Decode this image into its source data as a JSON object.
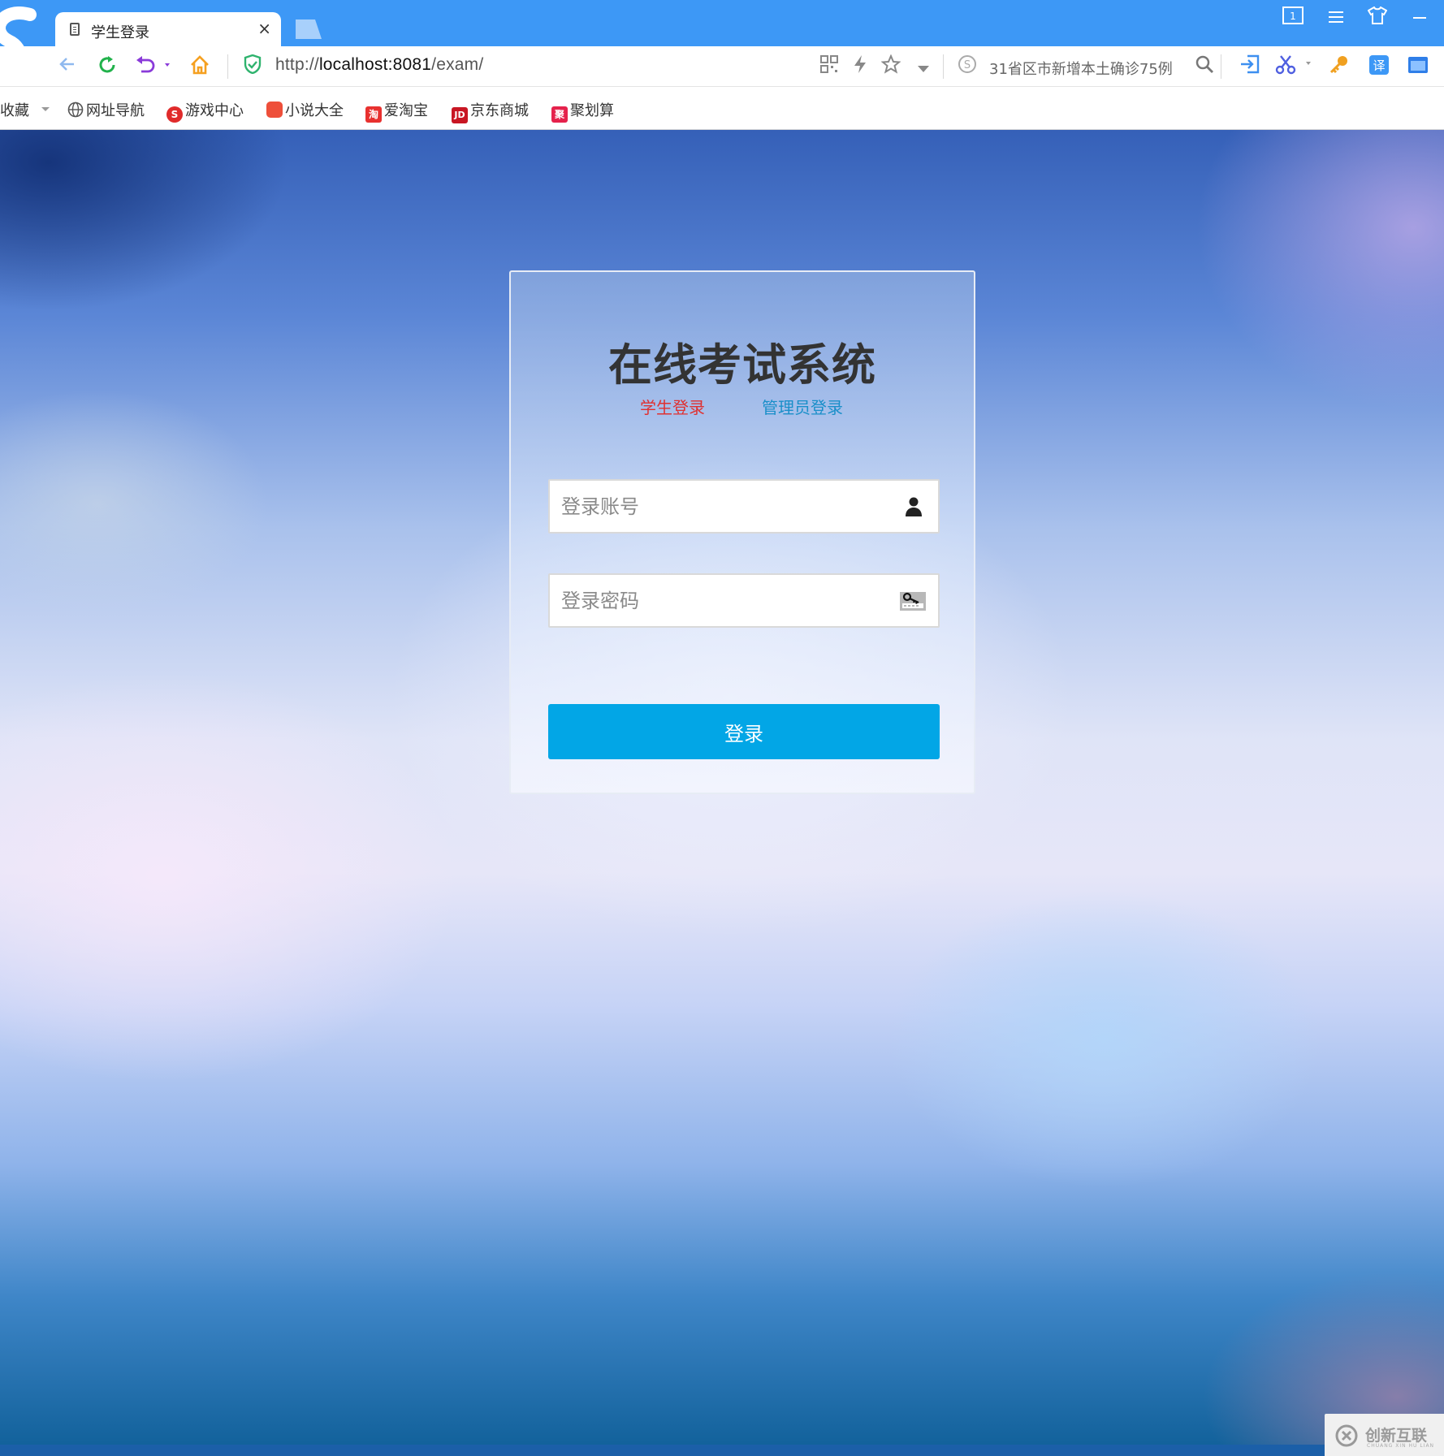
{
  "browser": {
    "tab_title": "学生登录",
    "tab_close": "×",
    "url_scheme": "http://",
    "url_host": "localhost:8081",
    "url_path": "/exam/",
    "news_ticker": "31省区市新增本土确诊75例",
    "window_counter": "1"
  },
  "bookmarks": [
    {
      "label": "收藏",
      "icon": "star-dropdown"
    },
    {
      "label": "网址导航",
      "icon": "globe-icon"
    },
    {
      "label": "游戏中心",
      "icon": "game-icon",
      "color": "#e02b2b",
      "glyph": "S"
    },
    {
      "label": "小说大全",
      "icon": "novel-icon",
      "color": "#ee4f3a",
      "glyph": ""
    },
    {
      "label": "爱淘宝",
      "icon": "taobao-icon",
      "color": "#e8312f",
      "glyph": "淘"
    },
    {
      "label": "京东商城",
      "icon": "jd-icon",
      "color": "#c81623",
      "glyph": "JD"
    },
    {
      "label": "聚划算",
      "icon": "juhuasuan-icon",
      "color": "#e5224c",
      "glyph": "聚"
    }
  ],
  "login": {
    "title": "在线考试系统",
    "student_login": "学生登录",
    "admin_login": "管理员登录",
    "account_placeholder": "登录账号",
    "account_value": "",
    "password_placeholder": "登录密码",
    "password_value": "",
    "submit_label": "登录"
  },
  "colors": {
    "student_link": "#e03030",
    "admin_link": "#1a8fc9",
    "button": "#02a6e6"
  },
  "watermark": {
    "text": "创新互联",
    "sub": "CHUANG XIN HU LIAN"
  }
}
